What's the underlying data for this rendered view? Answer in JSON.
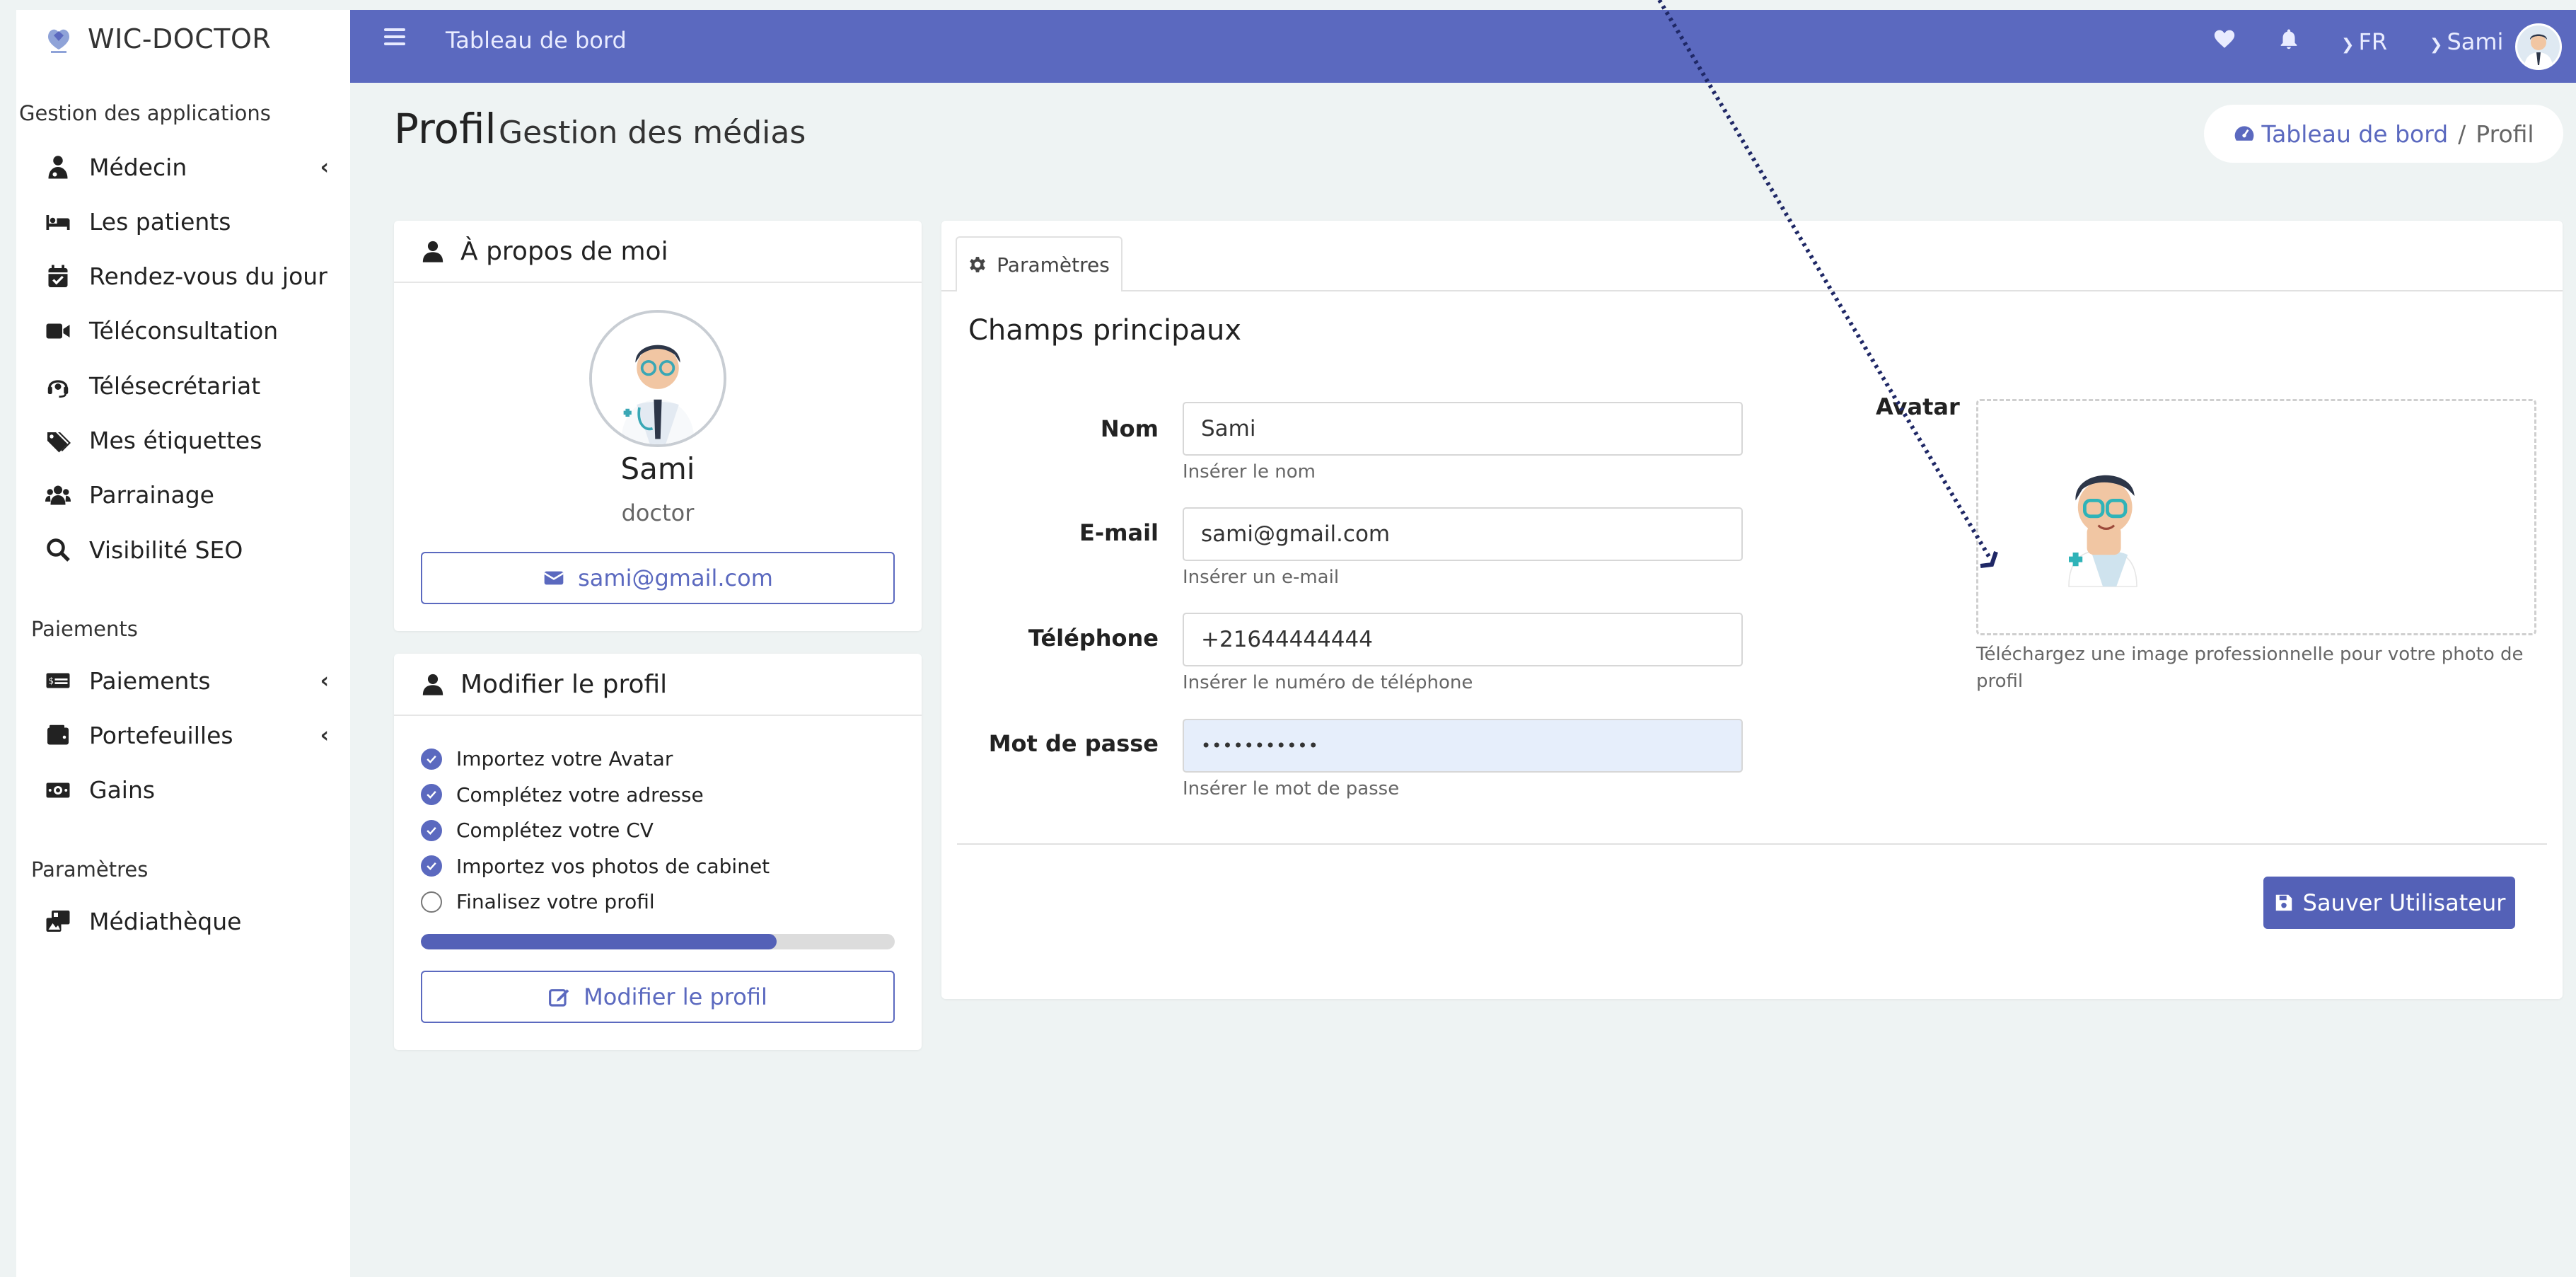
{
  "app": {
    "name": "WIC-DOCTOR"
  },
  "sidebar": {
    "section_apps": "Gestion des applications",
    "apps": [
      {
        "label": "Médecin",
        "icon": "doctor-icon",
        "has_chevron": true
      },
      {
        "label": "Les patients",
        "icon": "bed-icon",
        "has_chevron": false
      },
      {
        "label": "Rendez-vous du jour",
        "icon": "calendar-check-icon",
        "has_chevron": false
      },
      {
        "label": "Téléconsultation",
        "icon": "video-icon",
        "has_chevron": false
      },
      {
        "label": "Télésecrétariat",
        "icon": "headset-icon",
        "has_chevron": false
      },
      {
        "label": "Mes étiquettes",
        "icon": "tags-icon",
        "has_chevron": false
      },
      {
        "label": "Parrainage",
        "icon": "users-icon",
        "has_chevron": false
      },
      {
        "label": "Visibilité SEO",
        "icon": "search-icon",
        "has_chevron": false
      }
    ],
    "section_payments": "Paiements",
    "payments": [
      {
        "label": "Paiements",
        "icon": "money-check-icon",
        "has_chevron": true
      },
      {
        "label": "Portefeuilles",
        "icon": "wallet-icon",
        "has_chevron": true
      },
      {
        "label": "Gains",
        "icon": "money-bill-icon",
        "has_chevron": false
      }
    ],
    "section_settings": "Paramètres",
    "settings": [
      {
        "label": "Médiathèque",
        "icon": "photo-video-icon",
        "has_chevron": false
      }
    ]
  },
  "topbar": {
    "title": "Tableau de bord",
    "language": "FR",
    "user": "Sami",
    "color": "#5b69bf"
  },
  "page": {
    "title": "Profil",
    "subtitle": "Gestion des médias"
  },
  "breadcrumb": {
    "home": "Tableau de bord",
    "separator": "/",
    "current": "Profil"
  },
  "about": {
    "header": "À propos de moi",
    "name": "Sami",
    "role": "doctor",
    "email": "sami@gmail.com"
  },
  "edit_profile": {
    "header": "Modifier le profil",
    "tasks": [
      {
        "label": "Importez votre Avatar",
        "done": true
      },
      {
        "label": "Complétez votre adresse",
        "done": true
      },
      {
        "label": "Complétez votre CV",
        "done": true
      },
      {
        "label": "Importez vos photos de cabinet",
        "done": true
      },
      {
        "label": "Finalisez votre profil",
        "done": false
      }
    ],
    "progress": 0.75,
    "button": "Modifier le profil"
  },
  "form": {
    "tab": "Paramètres",
    "section_title": "Champs principaux",
    "fields": {
      "nom": {
        "label": "Nom",
        "value": "Sami",
        "help": "Insérer le nom"
      },
      "email": {
        "label": "E-mail",
        "value": "sami@gmail.com",
        "help": "Insérer un e-mail"
      },
      "phone": {
        "label": "Téléphone",
        "value": "+21644444444",
        "help": "Insérer le numéro de téléphone"
      },
      "password": {
        "label": "Mot de passe",
        "value": "•••••••••••",
        "help": "Insérer le mot de passe"
      }
    },
    "avatar": {
      "label": "Avatar",
      "help": "Téléchargez une image professionnelle pour votre photo de profil"
    },
    "save_button": "Sauver Utilisateur"
  }
}
